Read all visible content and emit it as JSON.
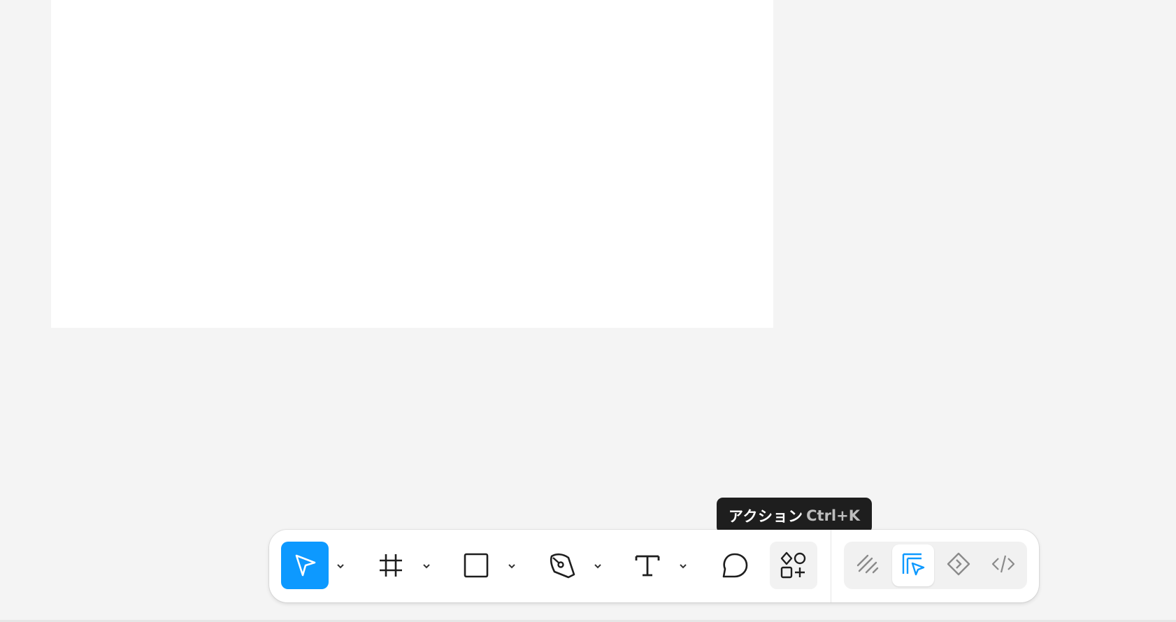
{
  "tooltip": {
    "label": "アクション",
    "shortcut": "Ctrl+K"
  },
  "toolbar": {
    "tools": [
      {
        "name": "move",
        "icon": "cursor-arrow-icon",
        "active": true
      },
      {
        "name": "frame",
        "icon": "frame-hash-icon"
      },
      {
        "name": "shape",
        "icon": "square-icon"
      },
      {
        "name": "pen",
        "icon": "pen-tool-icon"
      },
      {
        "name": "text",
        "icon": "text-t-icon"
      },
      {
        "name": "comment",
        "icon": "comment-bubble-icon"
      },
      {
        "name": "actions",
        "icon": "actions-grid-icon",
        "hover": true
      }
    ],
    "modes": [
      {
        "name": "draw",
        "icon": "scribble-icon"
      },
      {
        "name": "design",
        "icon": "design-pointer-icon",
        "selected": true
      },
      {
        "name": "prototype",
        "icon": "prototype-diamond-icon"
      },
      {
        "name": "dev",
        "icon": "code-brackets-icon"
      }
    ]
  },
  "colors": {
    "accent": "#0d99ff",
    "tooltip_bg": "#1e1e1e",
    "canvas_bg": "#f4f4f4"
  }
}
